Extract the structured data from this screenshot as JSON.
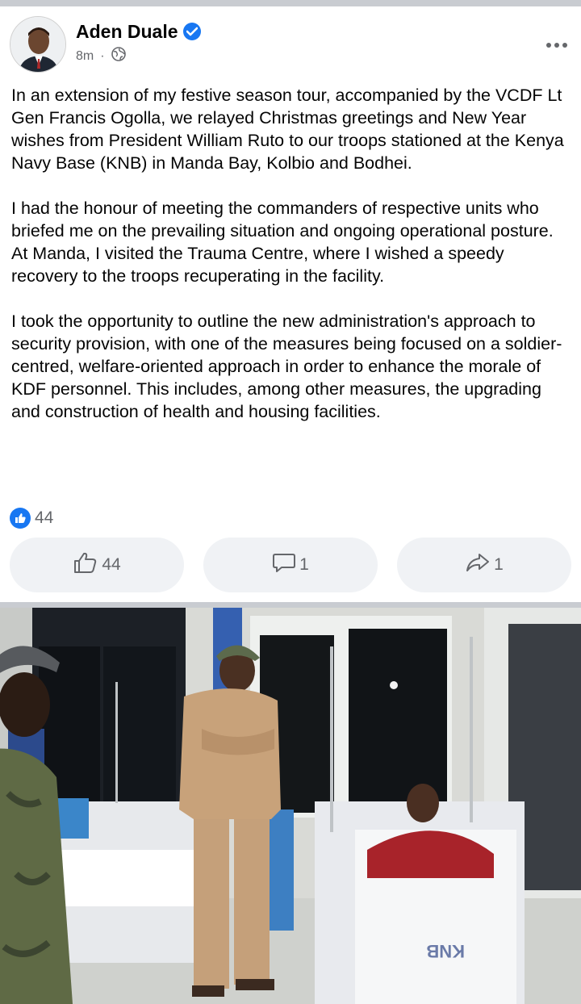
{
  "post": {
    "author": "Aden Duale",
    "time": "8m",
    "separator": "·",
    "paragraphs": [
      "In an extension of my festive season tour, accompanied by the VCDF Lt Gen Francis Ogolla, we relayed Christmas greetings and New Year wishes from President William Ruto to our troops stationed at the Kenya Navy Base (KNB) in Manda Bay, Kolbio and Bodhei.",
      "I had the honour of meeting the commanders of respective units who briefed me on the prevailing situation and ongoing operational posture. At Manda, I visited the Trauma Centre, where I wished a speedy recovery to the troops recuperating in the facility.",
      "I took the opportunity to outline the new administration's approach to security provision, with one of the measures being focused on a soldier-centred, welfare-oriented approach in order to enhance the morale of KDF personnel. This includes, among other measures, the upgrading and construction of health and housing facilities."
    ],
    "reaction_count": "44"
  },
  "actions": {
    "like_count": "44",
    "comment_count": "1",
    "share_count": "1"
  },
  "photo": {
    "bed_text": "KNB"
  },
  "colors": {
    "accent": "#1877f2",
    "muted": "#65676b",
    "button_bg": "#f0f2f5"
  }
}
